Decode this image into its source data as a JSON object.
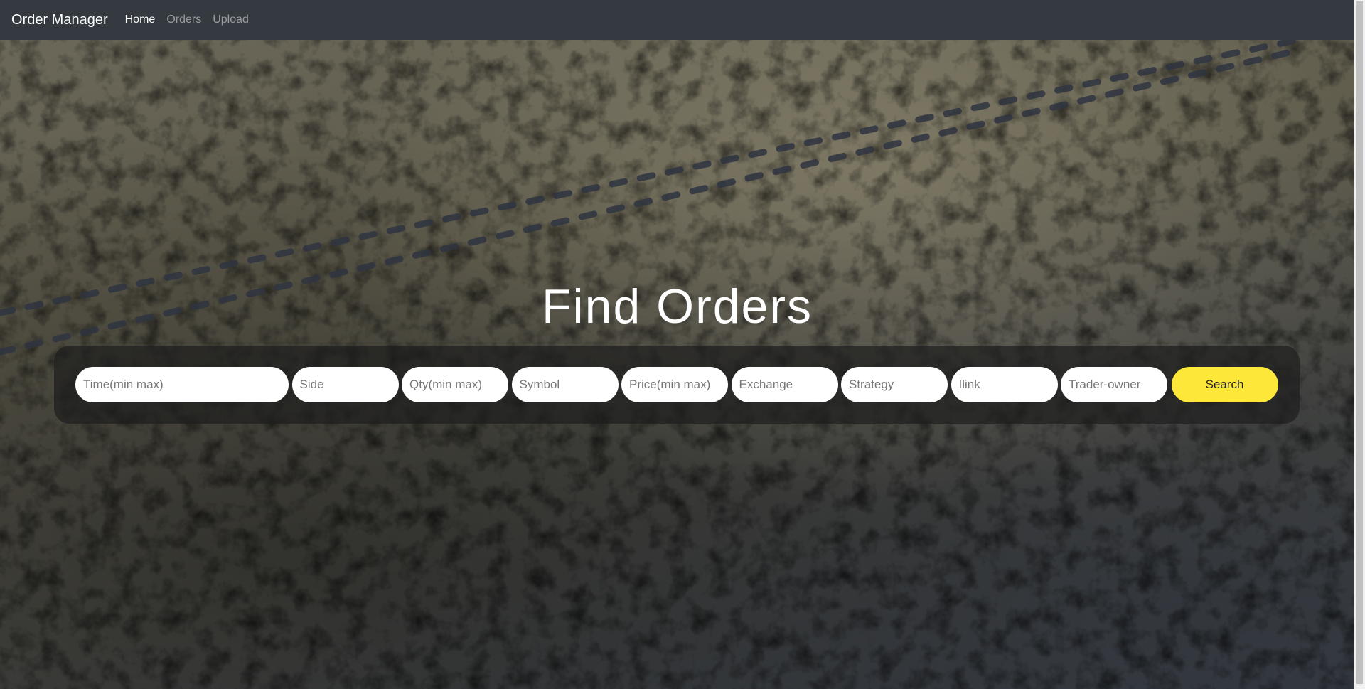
{
  "navbar": {
    "brand": "Order Manager",
    "links": [
      {
        "label": "Home",
        "active": true
      },
      {
        "label": "Orders",
        "active": false
      },
      {
        "label": "Upload",
        "active": false
      }
    ]
  },
  "hero": {
    "title": "Find Orders"
  },
  "search": {
    "fields": {
      "time": "Time(min max)",
      "side": "Side",
      "qty": "Qty(min max)",
      "symbol": "Symbol",
      "price": "Price(min max)",
      "exchange": "Exchange",
      "strategy": "Strategy",
      "ilink": "Ilink",
      "trader_owner": "Trader-owner"
    },
    "button_label": "Search",
    "button_color": "#fde738"
  },
  "colors": {
    "navbar_bg": "#343a40",
    "accent": "#fde738"
  }
}
